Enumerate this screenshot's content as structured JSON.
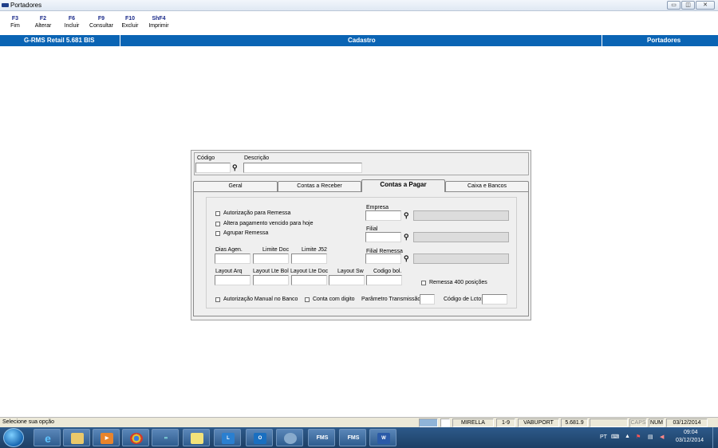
{
  "window": {
    "title": "Portadores",
    "min": "▭",
    "max": "◫",
    "close": "✕"
  },
  "fkeys": [
    {
      "key": "F3",
      "label": "Fim"
    },
    {
      "key": "F2",
      "label": "Alterar"
    },
    {
      "key": "F6",
      "label": "Incluir"
    },
    {
      "key": "F9",
      "label": "Consultar"
    },
    {
      "key": "F10",
      "label": "Excluir"
    },
    {
      "key": "ShF4",
      "label": "Imprimir"
    }
  ],
  "header": {
    "app": "G-RMS Retail 5.681 BIS",
    "section": "Cadastro",
    "screen": "Portadores"
  },
  "form": {
    "codigo_label": "Código",
    "codigo_value": "",
    "descricao_label": "Descrição",
    "descricao_value": ""
  },
  "tabs": [
    {
      "label": "Geral",
      "active": false
    },
    {
      "label": "Contas a Receber",
      "active": false
    },
    {
      "label": "Contas a Pagar",
      "active": true
    },
    {
      "label": "Caixa e Bancos",
      "active": false
    }
  ],
  "pagar": {
    "cb_autorizacao": "Autorização para Remessa",
    "cb_altera": "Altera pagamento vencido para hoje",
    "cb_agrupar": "Agrupar Remessa",
    "empresa_label": "Empresa",
    "filial_label": "Filial",
    "filial_remessa_label": "Filial Remessa",
    "dias_agen": "Dias Agen.",
    "limite_doc": "Limite Doc",
    "limite_j52": "Limite J52",
    "layout_arq": "Layout Arq",
    "layout_lte_bol": "Layout Lte Bol",
    "layout_lte_doc": "Layout Lte Doc",
    "layout_sw": "Layout Sw",
    "codigo_bol": "Codigo bol.",
    "cb_remessa400": "Remessa 400 posições",
    "cb_autorizacao_manual": "Autorização Manual no Banco",
    "cb_conta_digito": "Conta com digito",
    "parametro_transmissao": "Parâmetro Transmissão",
    "codigo_lcto": "Código de Lcto:"
  },
  "status": {
    "message": "Selecione sua opção",
    "user": "MIRELLA",
    "range": "1-9",
    "program": "VABUPORT",
    "version": "5.681.9",
    "caps": "CAPS",
    "num": "NUM",
    "date": "03/12/2014"
  },
  "taskbar": {
    "lang": "PT",
    "time": "09:04",
    "date": "03/12/2014",
    "apps": [
      "explorer",
      "ie",
      "folder",
      "media",
      "chrome",
      "app",
      "notes",
      "lync",
      "outlook",
      "app2",
      "fms",
      "fms",
      "word"
    ]
  }
}
